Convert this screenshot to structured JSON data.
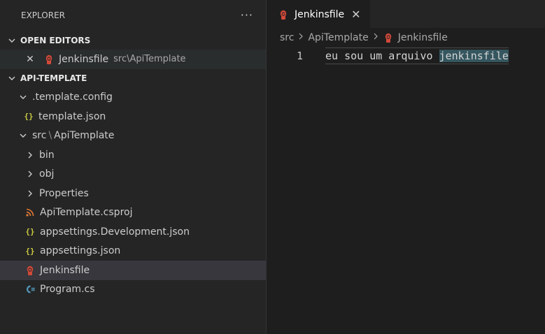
{
  "explorer": {
    "title": "EXPLORER",
    "more_label": "···"
  },
  "open_editors": {
    "header": "OPEN EDITORS",
    "items": [
      {
        "name": "Jenkinsfile",
        "path": "src\\ApiTemplate",
        "icon": "jenkins-icon"
      }
    ]
  },
  "project": {
    "header": "API-TEMPLATE",
    "tree": [
      {
        "label": ".template.config",
        "type": "folder",
        "expanded": true
      },
      {
        "label": "template.json",
        "type": "file",
        "icon": "json-icon"
      },
      {
        "label": "src",
        "label_sep": "\\",
        "label_tail": "ApiTemplate",
        "type": "folder",
        "expanded": true
      },
      {
        "label": "bin",
        "type": "folder",
        "expanded": false
      },
      {
        "label": "obj",
        "type": "folder",
        "expanded": false
      },
      {
        "label": "Properties",
        "type": "folder",
        "expanded": false
      },
      {
        "label": "ApiTemplate.csproj",
        "type": "file",
        "icon": "rss-icon"
      },
      {
        "label": "appsettings.Development.json",
        "type": "file",
        "icon": "json-icon"
      },
      {
        "label": "appsettings.json",
        "type": "file",
        "icon": "json-icon"
      },
      {
        "label": "Jenkinsfile",
        "type": "file",
        "icon": "jenkins-icon",
        "selected": true
      },
      {
        "label": "Program.cs",
        "type": "file",
        "icon": "csharp-icon"
      }
    ]
  },
  "editor": {
    "tab_label": "Jenkinsfile",
    "tab_close": "✕",
    "breadcrumb": [
      "src",
      "ApiTemplate",
      "Jenkinsfile"
    ],
    "line_number": "1",
    "code_plain": "eu sou um arquivo ",
    "code_highlight": "jenkinsfile"
  },
  "colors": {
    "sidebar_bg": "#252526",
    "editor_bg": "#1e1e1e",
    "selection": "#37373d",
    "jenkins_red": "#d24939",
    "json_yellow": "#cbcb41",
    "csharp_blue": "#519aba",
    "rss_orange": "#e37933"
  }
}
